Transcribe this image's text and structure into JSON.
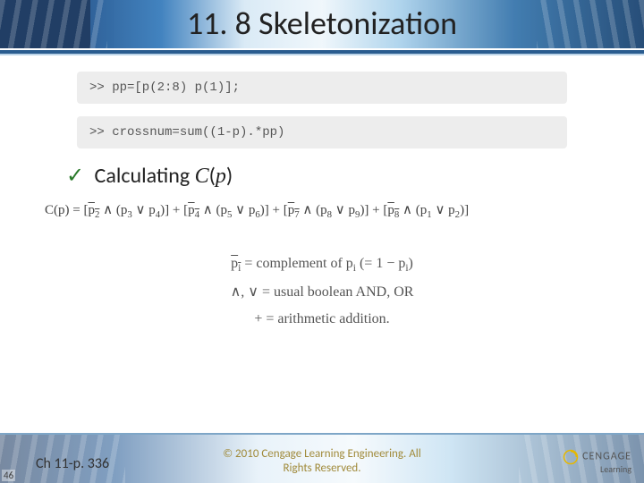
{
  "title": "11. 8 Skeletonization",
  "code": {
    "line1": ">> pp=[p(2:8) p(1)];",
    "line2": ">> crossnum=sum((1-p).*pp)"
  },
  "bullet": {
    "check": "✓",
    "text_prefix": "Calculating ",
    "ital_C": "C",
    "ital_p": "p"
  },
  "formula": {
    "lhs": "C(p) = ",
    "t1a": "p",
    "t1a_sub": "2",
    "t1b": "p",
    "t1b_sub": "3",
    "t1c": "p",
    "t1c_sub": "4",
    "t2a": "p",
    "t2a_sub": "4",
    "t2b": "p",
    "t2b_sub": "5",
    "t2c": "p",
    "t2c_sub": "6",
    "t3a": "p",
    "t3a_sub": "7",
    "t3b": "p",
    "t3b_sub": "8",
    "t3c": "p",
    "t3c_sub": "9",
    "t4a": "p",
    "t4a_sub": "8",
    "t4b": "p",
    "t4b_sub": "1",
    "t4c": "p",
    "t4c_sub": "2"
  },
  "legend": {
    "l1_a": "p",
    "l1_a_sub": "i",
    "l1_b": " = complement of ",
    "l1_c": "p",
    "l1_c_sub": "i",
    "l1_d": " (= 1 − p",
    "l1_d_sub": "i",
    "l1_e": ")",
    "l2": "∧, ∨ = usual boolean AND, OR",
    "l3": "+ = arithmetic addition."
  },
  "footer": {
    "page_ref": "Ch 11-p. 336",
    "copyright_line1": "© 2010 Cengage Learning Engineering. All",
    "copyright_line2": "Rights Reserved.",
    "brand_top": "CENGAGE",
    "brand_bottom": "Learning",
    "page_num": "46"
  }
}
